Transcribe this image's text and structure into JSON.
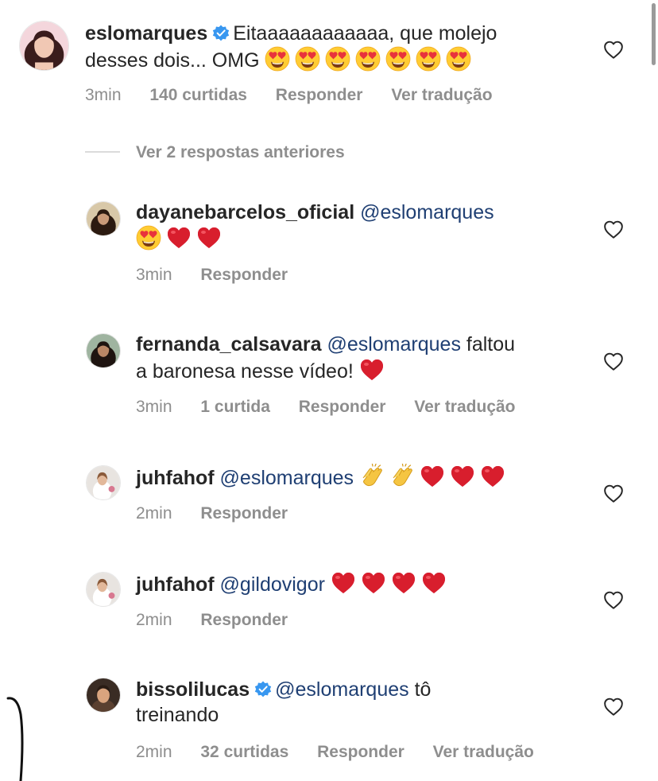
{
  "icons": {
    "heart_outline": "heart-outline-icon",
    "verified": "verified-badge-icon",
    "emoji_heart_eyes": "heart-eyes-emoji",
    "emoji_red_heart": "red-heart-emoji",
    "emoji_clapping": "clapping-hands-emoji"
  },
  "colors": {
    "text": "#262626",
    "meta": "#8e8e8e",
    "mention": "#1f3f73",
    "verified": "#3897f0",
    "heart_emoji": "#e0245e"
  },
  "main_comment": {
    "username": "eslomarques",
    "text_line1": "Eitaaaaaaaaaaaa, que molejo",
    "text_line2": "desses dois... OMG",
    "time": "3min",
    "likes": "140 curtidas",
    "reply": "Responder",
    "translate": "Ver tradução"
  },
  "view_replies": "Ver 2 respostas anteriores",
  "replies": [
    {
      "username": "dayanebarcelos_oficial",
      "mention": "@eslomarques",
      "time": "3min",
      "reply": "Responder"
    },
    {
      "username": "fernanda_calsavara",
      "mention": "@eslomarques",
      "text_line1_tail": "faltou",
      "text_line2": "a baronesa nesse vídeo!",
      "time": "3min",
      "likes": "1 curtida",
      "reply": "Responder",
      "translate": "Ver tradução"
    },
    {
      "username": "juhfahof",
      "mention": "@eslomarques",
      "time": "2min",
      "reply": "Responder"
    },
    {
      "username": "juhfahof",
      "mention": "@gildovigor",
      "time": "2min",
      "reply": "Responder"
    },
    {
      "username": "bissolilucas",
      "mention": "@eslomarques",
      "text_line1_tail": "tô",
      "text_line2": "treinando",
      "time": "2min",
      "likes": "32 curtidas",
      "reply": "Responder",
      "translate": "Ver tradução"
    }
  ]
}
